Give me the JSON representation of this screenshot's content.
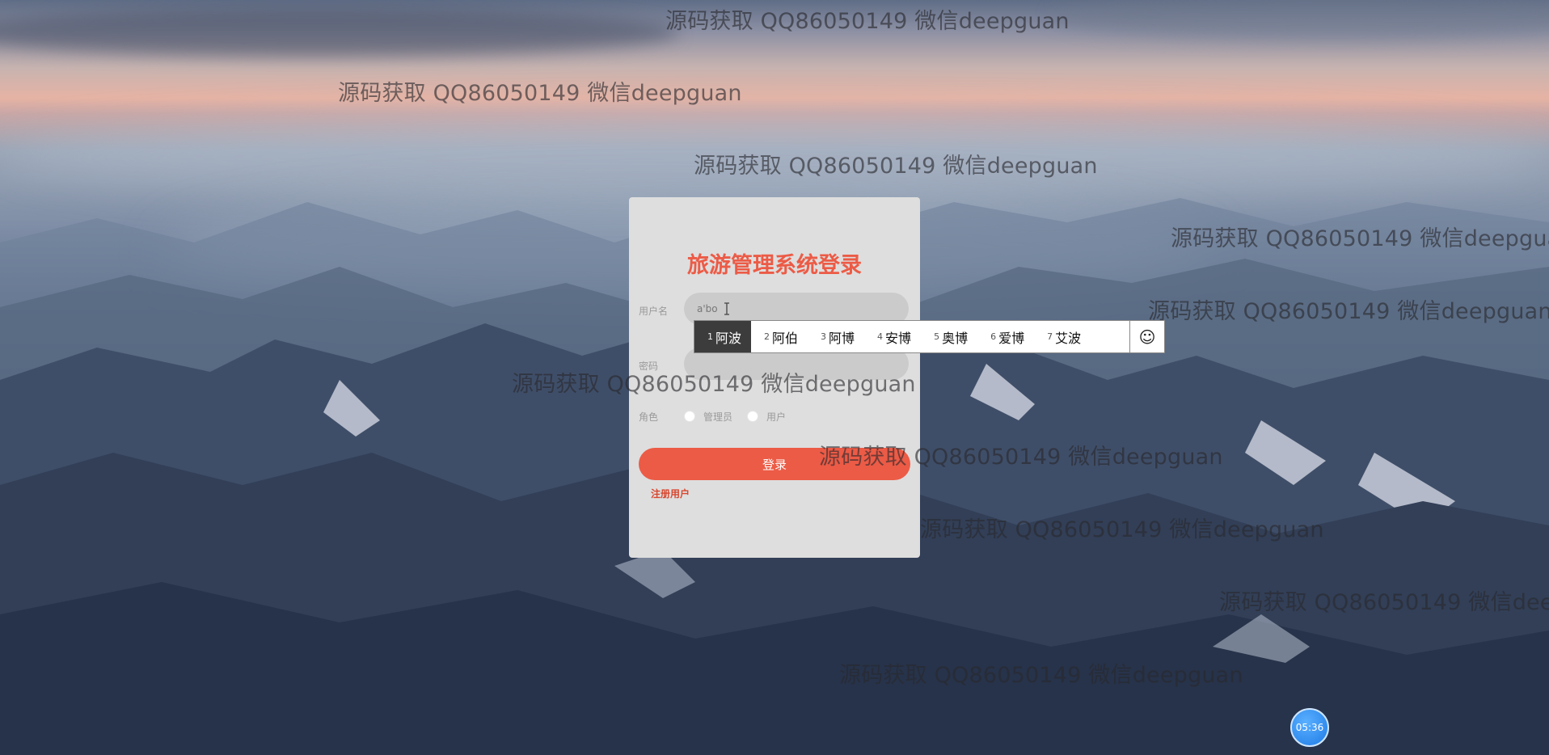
{
  "watermark_text": "源码获取 QQ86050149 微信deepguan",
  "login": {
    "title": "旅游管理系统登录",
    "username_label": "用户名",
    "username_value": "a'bo",
    "password_label": "密码",
    "role_label": "角色",
    "role_options": [
      "管理员",
      "用户"
    ],
    "submit_label": "登录",
    "register_link": "注册用户"
  },
  "ime": {
    "candidates": [
      {
        "num": "1",
        "text": "阿波"
      },
      {
        "num": "2",
        "text": "阿伯"
      },
      {
        "num": "3",
        "text": "阿博"
      },
      {
        "num": "4",
        "text": "安博"
      },
      {
        "num": "5",
        "text": "奥博"
      },
      {
        "num": "6",
        "text": "爱博"
      },
      {
        "num": "7",
        "text": "艾波"
      }
    ],
    "selected_index": 0,
    "emoji_icon": "smiley-face-icon"
  },
  "clock": {
    "time": "05:36"
  },
  "colors": {
    "accent": "#ec5b46",
    "card": "#dedede",
    "field": "#cbcbcb"
  }
}
